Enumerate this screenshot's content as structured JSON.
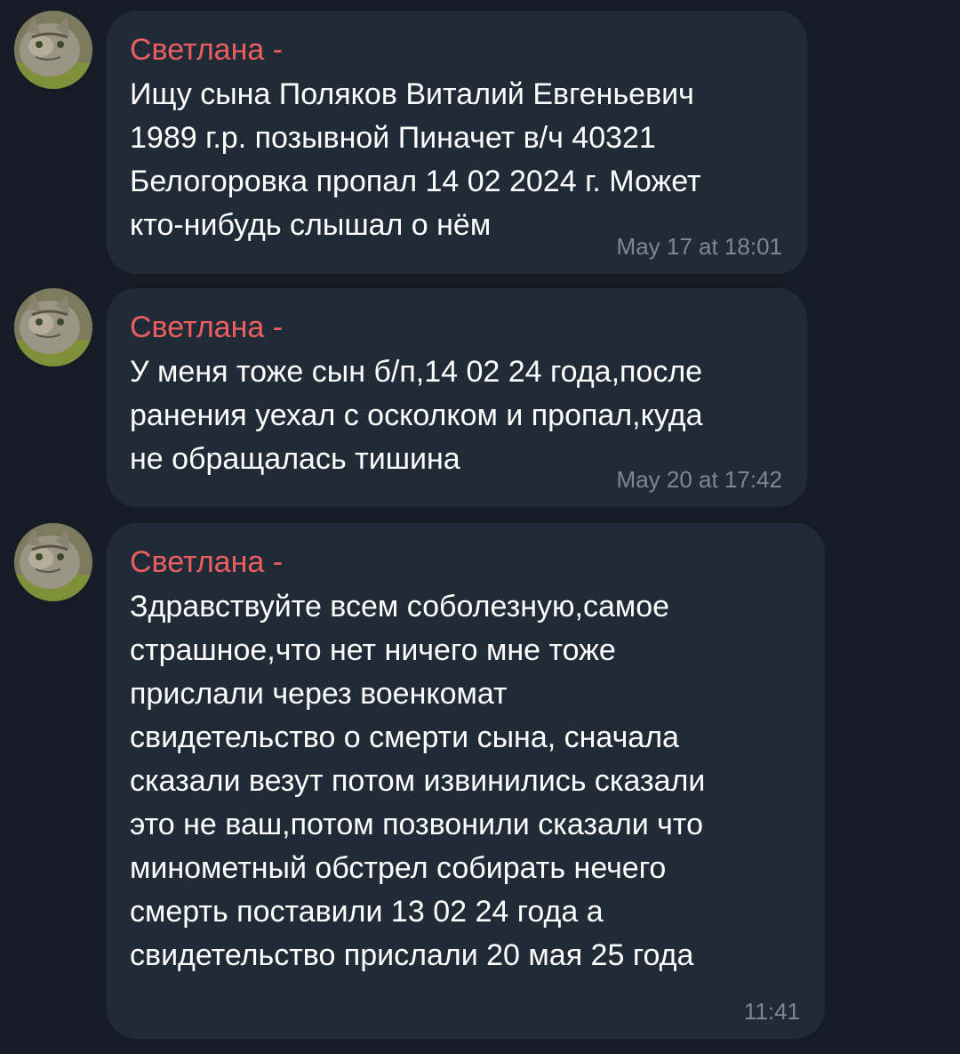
{
  "messages": [
    {
      "sender": "Светлана -",
      "text": "Ищу сына Поляков Виталий Евгеньевич\n1989 г.р. позывной Пиначет в/ч 40321\nБелогоровка пропал 14 02 2024 г. Может\nкто-нибудь слышал о нём",
      "time": "May 17 at 18:01",
      "avatar": "cat-avatar"
    },
    {
      "sender": "Светлана -",
      "text": "У меня тоже сын б/п,14 02 24 года,после\nранения уехал с осколком и пропал,куда\nне обращалась тишина",
      "time": "May 20 at 17:42",
      "avatar": "cat-avatar"
    },
    {
      "sender": "Светлана -",
      "text": "Здравствуйте всем соболезную,самое\nстрашное,что нет ничего мне тоже\nприслали через военкомат\nсвидетельство о смерти сына, сначала\nсказали везут потом извинились сказали\nэто не ваш,потом позвонили сказали что\nминометный обстрел собирать нечего\nсмерть поставили 13 02 24 года а\nсвидетельство прислали 20 мая 25 года",
      "time": "11:41",
      "avatar": "cat-avatar"
    }
  ],
  "colors": {
    "background": "#151c25",
    "bubble": "#202b37",
    "sender": "#ed5f5f",
    "text": "#ffffff",
    "time": "#7c8794"
  }
}
